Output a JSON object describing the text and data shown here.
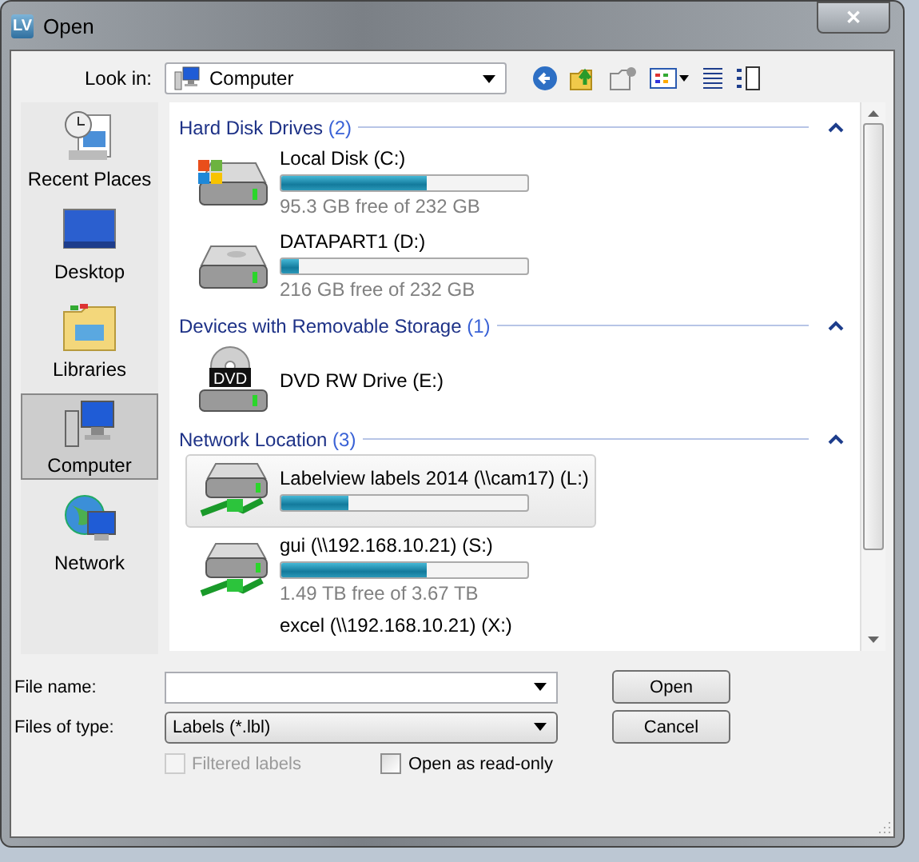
{
  "window": {
    "app_icon": "LV",
    "title": "Open",
    "close": "✕"
  },
  "look_in": {
    "label": "Look in:",
    "value": "Computer"
  },
  "sidebar": {
    "items": [
      {
        "label": "Recent Places",
        "kind": "recent",
        "selected": false
      },
      {
        "label": "Desktop",
        "kind": "desktop",
        "selected": false
      },
      {
        "label": "Libraries",
        "kind": "libraries",
        "selected": false
      },
      {
        "label": "Computer",
        "kind": "computer",
        "selected": true
      },
      {
        "label": "Network",
        "kind": "network",
        "selected": false
      }
    ]
  },
  "groups": [
    {
      "title": "Hard Disk Drives",
      "count": "(2)",
      "expanded": true,
      "items": [
        {
          "name": "Local Disk (C:)",
          "kind": "hdd-windows",
          "level": 0.59,
          "free": "95.3 GB free of 232 GB",
          "selected": false
        },
        {
          "name": "DATAPART1 (D:)",
          "kind": "hdd",
          "level": 0.07,
          "free": "216 GB free of 232 GB",
          "selected": false
        }
      ]
    },
    {
      "title": "Devices with Removable Storage",
      "count": "(1)",
      "expanded": true,
      "items": [
        {
          "name": "DVD RW Drive (E:)",
          "kind": "dvd",
          "badge": "DVD",
          "selected": false
        }
      ]
    },
    {
      "title": "Network Location",
      "count": "(3)",
      "expanded": true,
      "items": [
        {
          "name": "Labelview labels 2014 (\\\\cam17) (L:)",
          "kind": "network",
          "level": 0.27,
          "selected": true
        },
        {
          "name": "gui (\\\\192.168.10.21) (S:)",
          "kind": "network",
          "level": 0.59,
          "free": "1.49 TB free of 3.67 TB",
          "selected": false
        },
        {
          "name": "excel (\\\\192.168.10.21) (X:)",
          "kind": "network-partial",
          "selected": false
        }
      ]
    }
  ],
  "file_name": {
    "label": "File name:"
  },
  "file_type": {
    "label": "Files of type:",
    "value": "Labels (*.lbl)"
  },
  "buttons": [
    {
      "label": "Open"
    },
    {
      "label": "Cancel"
    }
  ],
  "options": [
    {
      "label": "Filtered labels",
      "checked": false,
      "disabled": true
    },
    {
      "label": "Open as read-only",
      "checked": false,
      "disabled": false
    }
  ]
}
